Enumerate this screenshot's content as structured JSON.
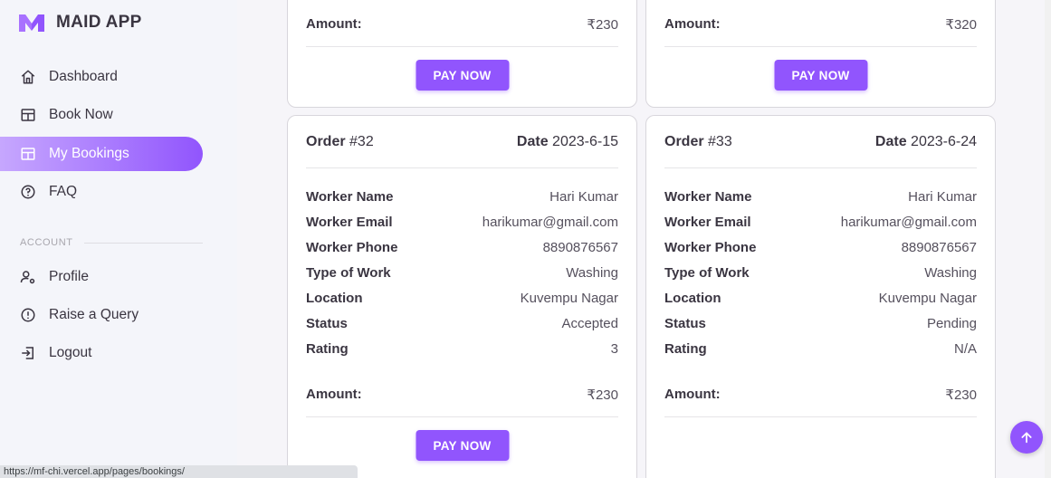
{
  "app": {
    "name": "MAID APP"
  },
  "sidebar": {
    "items": [
      {
        "label": "Dashboard",
        "icon": "home-icon"
      },
      {
        "label": "Book Now",
        "icon": "table-icon"
      },
      {
        "label": "My Bookings",
        "icon": "table-icon",
        "active": true
      },
      {
        "label": "FAQ",
        "icon": "help-circle-icon"
      }
    ],
    "section_label": "ACCOUNT",
    "account_items": [
      {
        "label": "Profile",
        "icon": "account-cog-icon"
      },
      {
        "label": "Raise a Query",
        "icon": "alert-circle-icon"
      },
      {
        "label": "Logout",
        "icon": "logout-icon"
      }
    ]
  },
  "labels": {
    "amount": "Amount:",
    "order": "Order",
    "date": "Date",
    "worker_name": "Worker Name",
    "worker_email": "Worker Email",
    "worker_phone": "Worker Phone",
    "type_of_work": "Type of Work",
    "location": "Location",
    "status": "Status",
    "rating": "Rating",
    "pay_now": "PAY NOW"
  },
  "top_cards": [
    {
      "amount": "₹230"
    },
    {
      "amount": "₹320"
    }
  ],
  "orders": [
    {
      "order_no": "#32",
      "date": "2023-6-15",
      "worker_name": "Hari Kumar",
      "worker_email": "harikumar@gmail.com",
      "worker_phone": "8890876567",
      "type_of_work": "Washing",
      "location": "Kuvempu Nagar",
      "status": "Accepted",
      "rating": "3",
      "amount": "₹230"
    },
    {
      "order_no": "#33",
      "date": "2023-6-24",
      "worker_name": "Hari Kumar",
      "worker_email": "harikumar@gmail.com",
      "worker_phone": "8890876567",
      "type_of_work": "Washing",
      "location": "Kuvempu Nagar",
      "status": "Pending",
      "rating": "N/A",
      "amount": "₹230"
    }
  ],
  "status_bar": {
    "url": "https://mf-chi.vercel.app/pages/bookings/"
  },
  "colors": {
    "accent": "#9155fd",
    "accent_light": "#c6a7fe"
  }
}
